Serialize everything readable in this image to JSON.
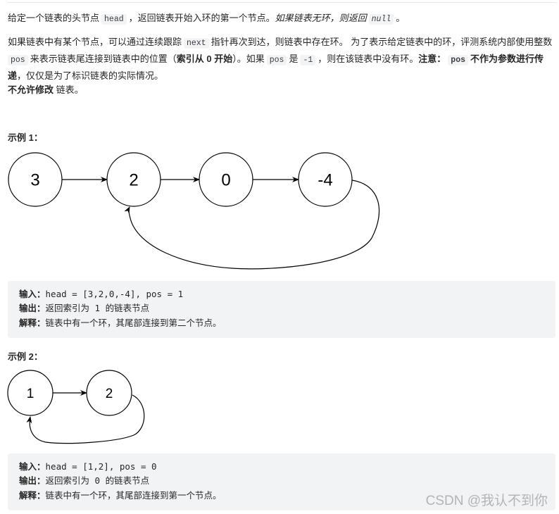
{
  "intro": {
    "p1": {
      "t1": "给定一个链表的头节点",
      "code1": "head",
      "t2": "，返回链表开始入环的第一个节点。",
      "italic": "如果链表无环，则返回",
      "code2": "null",
      "t3": "。"
    },
    "p2": {
      "t1": "如果链表中有某个节点，可以通过连续跟踪",
      "code1": "next",
      "t2": "指针再次到达，则链表中存在环。 为了表示给定链表中的环，评测系统内部使用整数",
      "code2": "pos",
      "t3": "来表示链表尾连接到链表中的位置（",
      "bold1": "索引从 0 开始",
      "t4": "）。如果",
      "code3": "pos",
      "t5": "是",
      "code4": "-1",
      "t6": "，则在该链表中没有环。",
      "bold2": "注意：",
      "code5": "pos",
      "bold3": "不作为参数进行传递",
      "t7": "，仅仅是为了标识链表的实际情况。"
    },
    "p3": {
      "bold": "不允许修改",
      "t1": " 链表。"
    }
  },
  "examples": [
    {
      "title": "示例 1：",
      "nodes": [
        "3",
        "2",
        "0",
        "-4"
      ],
      "cycle_to_index": 1,
      "input_label": "输入：",
      "input_value": "head = [3,2,0,-4], pos = 1",
      "output_label": "输出：",
      "output_value": "返回索引为 1 的链表节点",
      "explain_label": "解释：",
      "explain_value": "链表中有一个环，其尾部连接到第二个节点。"
    },
    {
      "title": "示例 2：",
      "nodes": [
        "1",
        "2"
      ],
      "cycle_to_index": 0,
      "input_label": "输入：",
      "input_value": "head = [1,2], pos = 0",
      "output_label": "输出：",
      "output_value": "返回索引为 0 的链表节点",
      "explain_label": "解释：",
      "explain_value": "链表中有一个环，其尾部连接到第一个节点。"
    }
  ],
  "watermark": "CSDN @我认不到你"
}
